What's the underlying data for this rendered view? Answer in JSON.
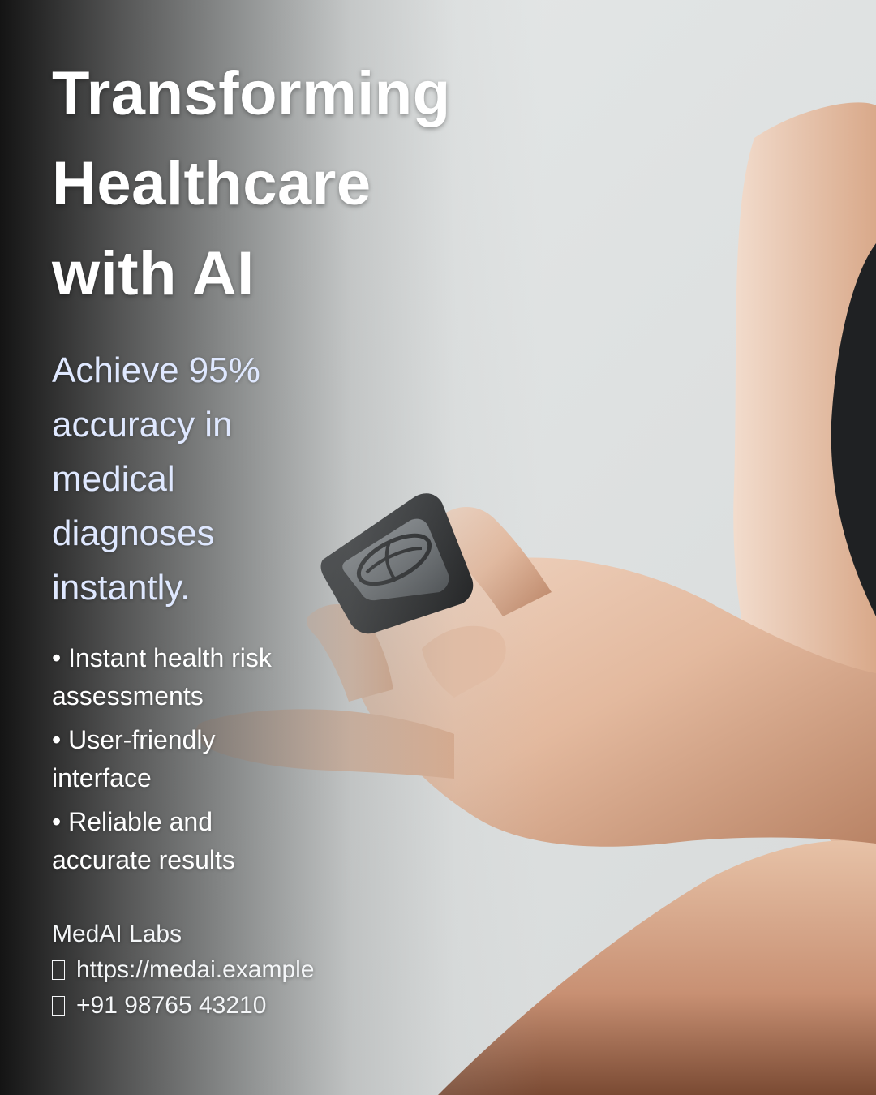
{
  "headline": {
    "lines": [
      "Transforming",
      "Healthcare",
      "with AI"
    ]
  },
  "subhead": {
    "lines": [
      "Achieve 95%",
      "accuracy in",
      "medical",
      "diagnoses",
      "instantly."
    ]
  },
  "bullets": [
    {
      "lines": [
        "• Instant health risk",
        "assessments"
      ]
    },
    {
      "lines": [
        "• User-friendly",
        "interface"
      ]
    },
    {
      "lines": [
        "• Reliable and",
        "accurate results"
      ]
    }
  ],
  "footer": {
    "company": "MedAI Labs",
    "website": "https://medai.example",
    "phone": "+91 98765 43210",
    "website_icon": "link-icon",
    "phone_icon": "phone-icon"
  },
  "colors": {
    "headline": "#ffffff",
    "subhead": "#dfe8ff",
    "body": "#ffffff"
  }
}
